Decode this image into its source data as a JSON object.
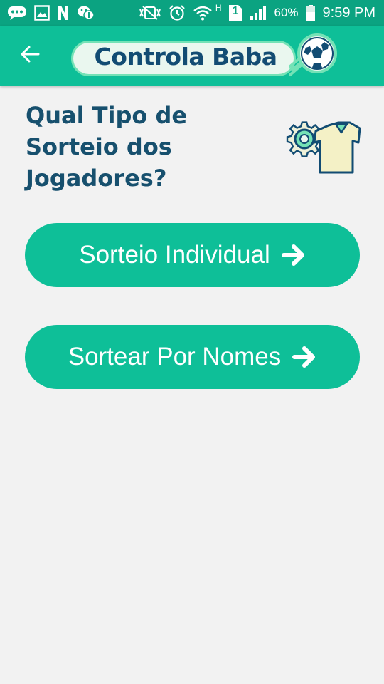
{
  "status_bar": {
    "battery_percent": "60%",
    "time": "9:59 PM",
    "network_type": "H",
    "sim_slot": "1",
    "icons": [
      "chat-icon",
      "image-icon",
      "n-app-icon",
      "wechat-icon",
      "vibrate-icon",
      "alarm-icon",
      "wifi-icon",
      "sim-icon",
      "signal-icon",
      "battery-icon"
    ]
  },
  "app_bar": {
    "logo_text": "Controla Baba",
    "icons": [
      "back-arrow-icon",
      "soccer-ball-icon"
    ]
  },
  "main": {
    "question": "Qual Tipo de Sorteio dos Jogadores?",
    "illustration_icon": "gear-shirt-icon",
    "buttons": [
      {
        "label": "Sorteio Individual",
        "icon": "arrow-right-icon"
      },
      {
        "label": "Sortear Por Nomes",
        "icon": "arrow-right-icon"
      }
    ]
  },
  "colors": {
    "status_bar": "#0ba381",
    "app_bar": "#0ebf98",
    "button": "#0ebf98",
    "question_text": "#17506e",
    "logo_text": "#124c73",
    "background": "#f2f2f2"
  }
}
